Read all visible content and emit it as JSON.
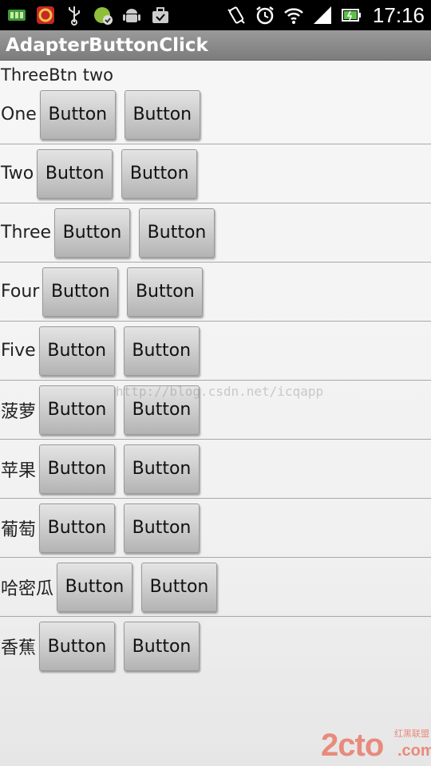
{
  "status_bar": {
    "time": "17:16",
    "left_icons": [
      "sim-icon",
      "app-icon",
      "usb-icon",
      "android-helper-icon",
      "android-icon",
      "briefcase-icon"
    ],
    "right_icons": [
      "vibrate-icon",
      "alarm-icon",
      "wifi-icon",
      "signal-icon",
      "battery-icon"
    ]
  },
  "app": {
    "title": "AdapterButtonClick"
  },
  "header": {
    "text": "ThreeBtn two"
  },
  "rows": [
    {
      "label": "One",
      "buttons": [
        "Button",
        "Button"
      ]
    },
    {
      "label": "Two",
      "buttons": [
        "Button",
        "Button"
      ]
    },
    {
      "label": "Three",
      "buttons": [
        "Button",
        "Button"
      ]
    },
    {
      "label": "Four",
      "buttons": [
        "Button",
        "Button"
      ]
    },
    {
      "label": "Five",
      "buttons": [
        "Button",
        "Button"
      ]
    },
    {
      "label": "菠萝",
      "buttons": [
        "Button",
        "Button"
      ]
    },
    {
      "label": "苹果",
      "buttons": [
        "Button",
        "Button"
      ]
    },
    {
      "label": "葡萄",
      "buttons": [
        "Button",
        "Button"
      ]
    },
    {
      "label": "哈密瓜",
      "buttons": [
        "Button",
        "Button"
      ]
    },
    {
      "label": "香蕉",
      "buttons": [
        "Button",
        "Button"
      ]
    }
  ],
  "watermark": {
    "url": "http://blog.csdn.net/icqapp",
    "logo_main": "2cto",
    "logo_small": "红黑联盟",
    "logo_com": ".com"
  }
}
